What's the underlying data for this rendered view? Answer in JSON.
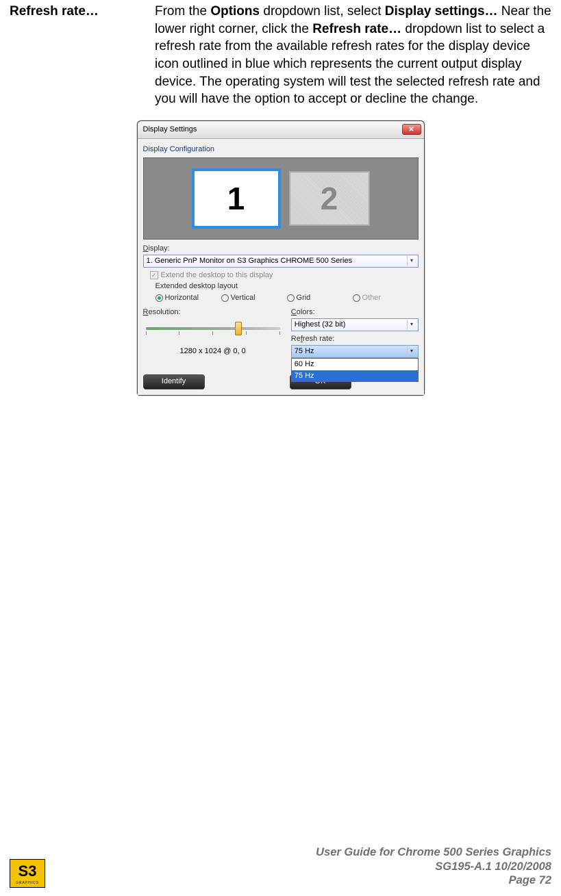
{
  "entry": {
    "label": "Refresh rate…",
    "desc_prefix": "From the ",
    "bold1": "Options",
    "desc_mid1": " dropdown list, select ",
    "bold2": "Display settings…",
    "desc_mid2": " Near the lower right corner, click the ",
    "bold3": "Refresh rate…",
    "desc_suffix": " dropdown list to select a refresh rate from the available refresh rates for the display device icon outlined in blue which represents the current output display device. The operating system will test the selected refresh rate and you will have the option to accept or decline the change."
  },
  "dialog": {
    "title": "Display Settings",
    "section_config": "Display Configuration",
    "monitor1": "1",
    "monitor2": "2",
    "display_label_prefix": "D",
    "display_label_rest": "isplay:",
    "display_value": "1. Generic PnP Monitor on S3 Graphics CHROME 500 Series",
    "extend_prefix": "E",
    "extend_rest": "xtend the desktop to this display",
    "layout_title": "Extended desktop layout",
    "layout": {
      "horizontal_prefix": "H",
      "horizontal_rest": "orizontal",
      "vertical_prefix": "V",
      "vertical_rest": "ertical",
      "grid_prefix": "G",
      "grid_rest": "rid",
      "other_prefix": "O",
      "other_rest": "ther"
    },
    "resolution_label_prefix": "R",
    "resolution_label_rest": "esolution:",
    "resolution_value": "1280 x 1024 @ 0, 0",
    "colors_label_prefix": "C",
    "colors_label_rest": "olors:",
    "colors_value": "Highest (32 bit)",
    "refresh_label_prefix": "Re",
    "refresh_label_ul": "f",
    "refresh_label_rest": "resh rate:",
    "refresh_value": "75 Hz",
    "refresh_options": [
      "60 Hz",
      "75 Hz"
    ],
    "identify_btn": "Identify",
    "ok_btn": "OK"
  },
  "footer": {
    "line1": "User Guide for Chrome 500 Series Graphics",
    "line2": "SG195-A.1   10/20/2008",
    "page_label": "Page ",
    "page_num": "72",
    "logo_main": "S3",
    "logo_sub": "GRAPHICS"
  }
}
